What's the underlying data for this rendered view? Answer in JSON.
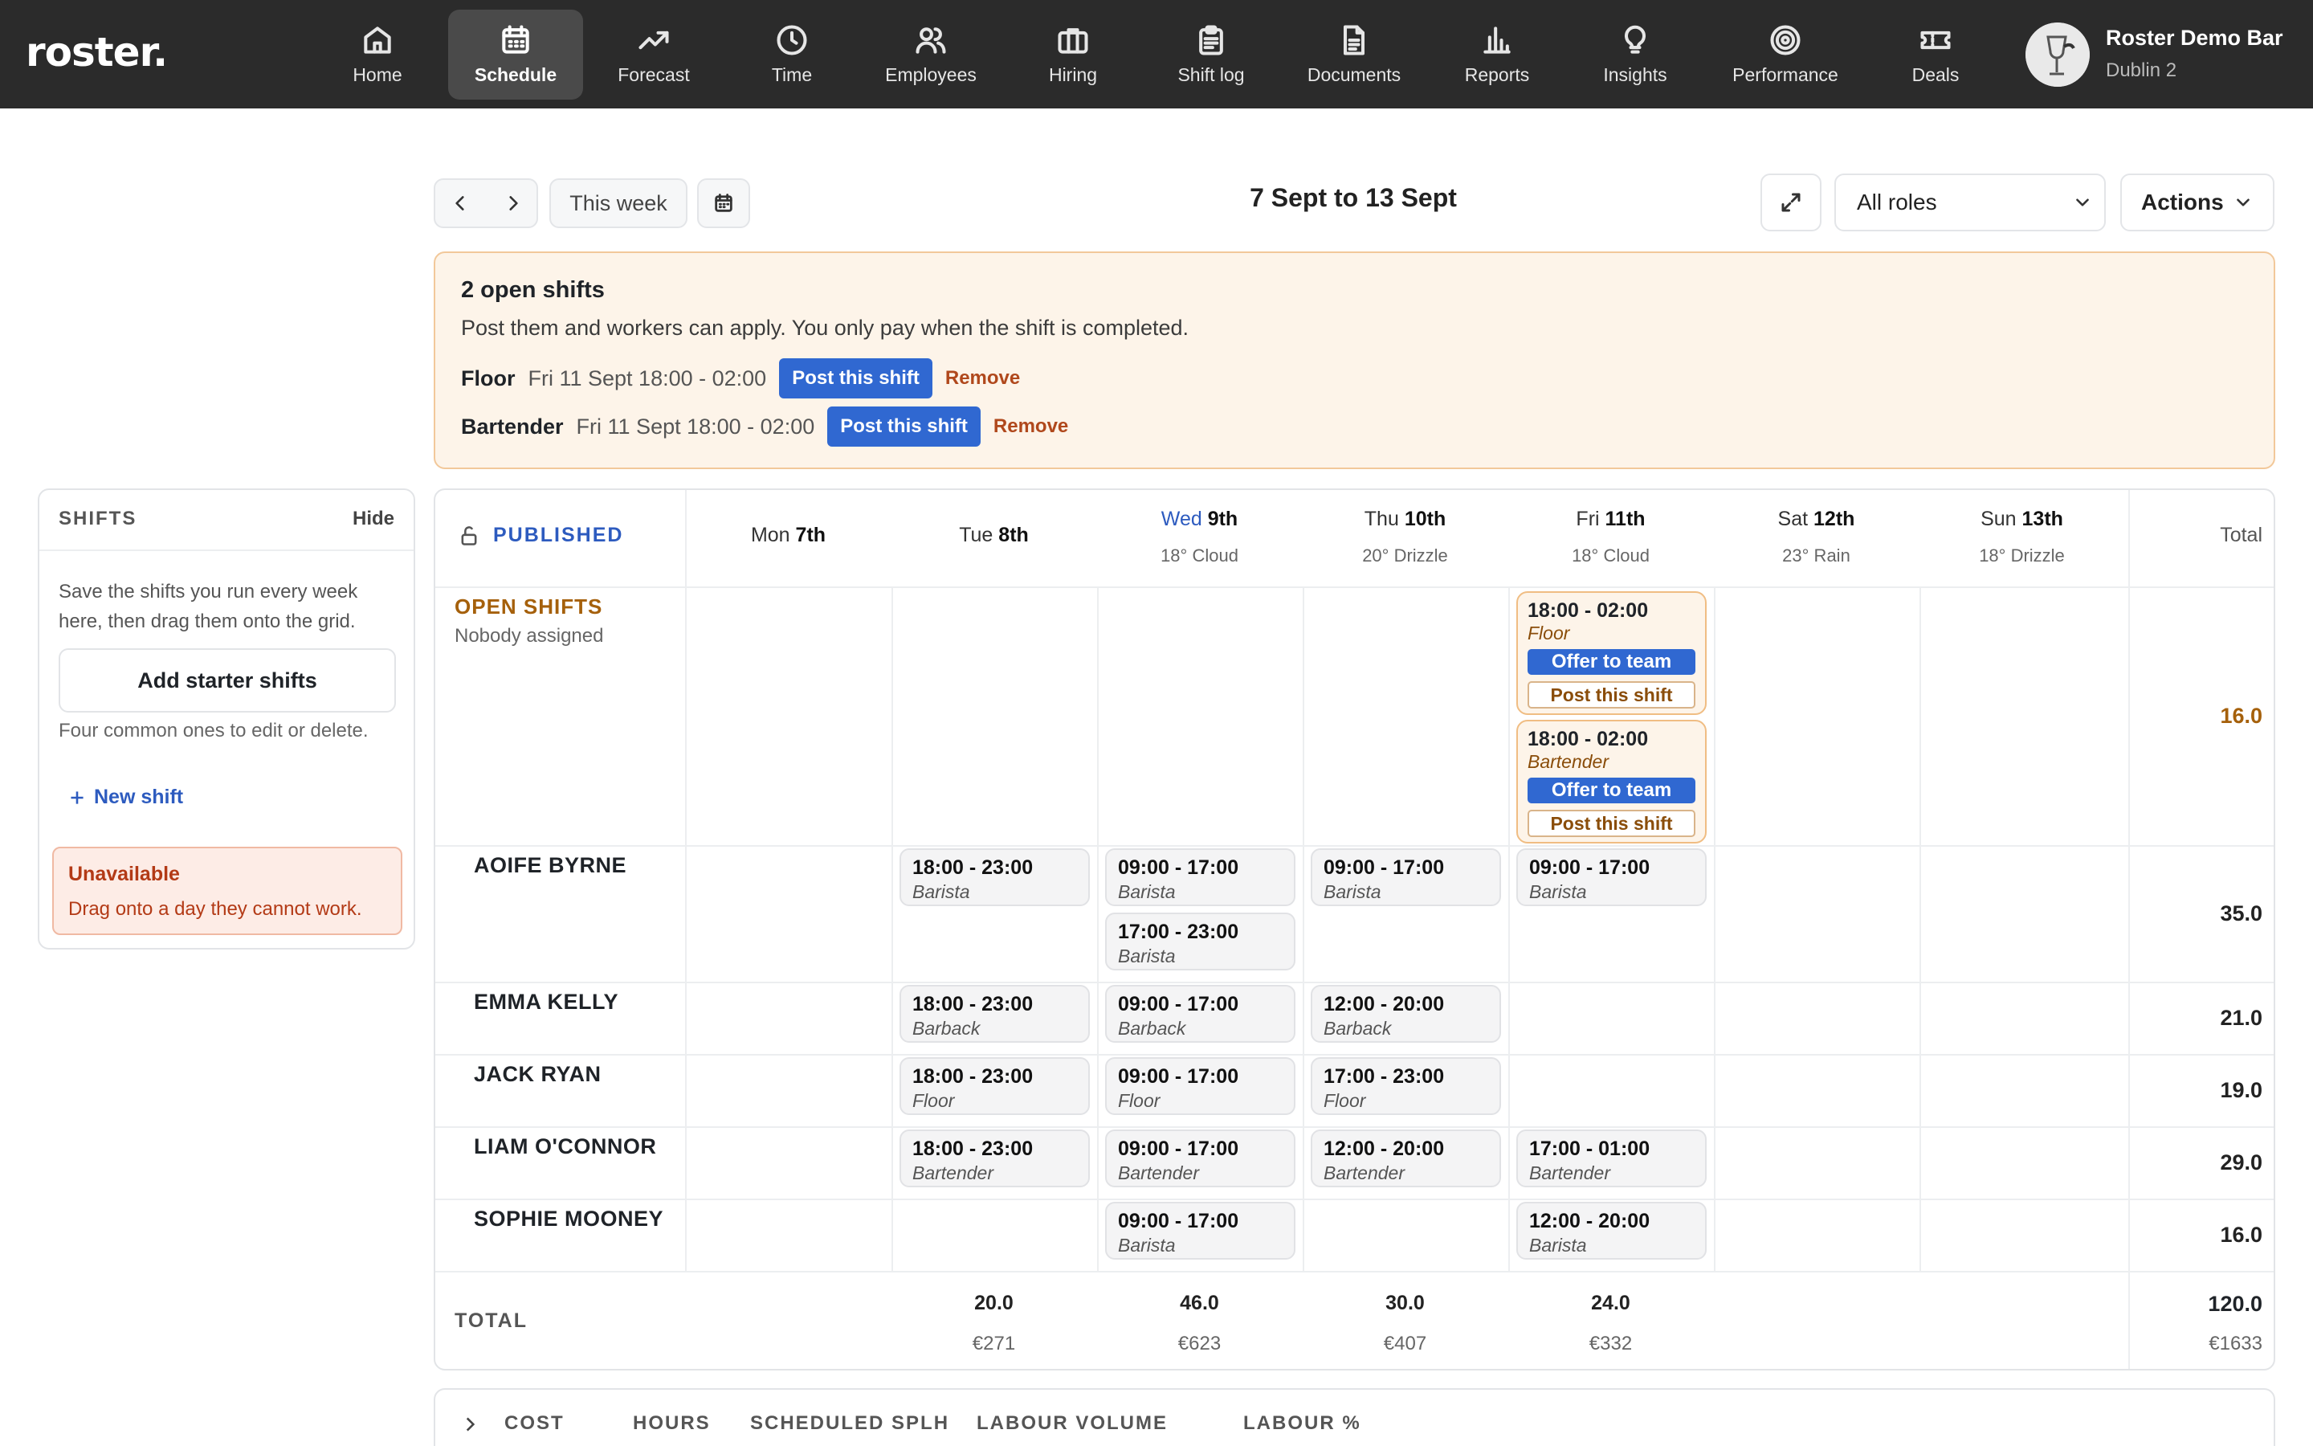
{
  "brand": {
    "logo": "roster."
  },
  "nav": [
    {
      "label": "Home",
      "icon": "home-icon"
    },
    {
      "label": "Schedule",
      "icon": "calendar-icon",
      "active": true
    },
    {
      "label": "Forecast",
      "icon": "trend-icon"
    },
    {
      "label": "Time",
      "icon": "clock-icon"
    },
    {
      "label": "Employees",
      "icon": "users-icon"
    },
    {
      "label": "Hiring",
      "icon": "briefcase-icon"
    },
    {
      "label": "Shift log",
      "icon": "clipboard-icon"
    },
    {
      "label": "Documents",
      "icon": "document-icon"
    },
    {
      "label": "Reports",
      "icon": "bar-chart-icon"
    },
    {
      "label": "Insights",
      "icon": "lightbulb-icon"
    },
    {
      "label": "Performance",
      "icon": "target-icon"
    },
    {
      "label": "Deals",
      "icon": "ticket-icon"
    }
  ],
  "account": {
    "name": "Roster Demo Bar",
    "location": "Dublin 2"
  },
  "toolbar": {
    "this_week": "This week",
    "range": "7 Sept to 13 Sept",
    "role_filter": "All roles",
    "actions": "Actions"
  },
  "banner": {
    "title": "2 open shifts",
    "desc": "Post them and workers can apply. You only pay when the shift is completed.",
    "rows": [
      {
        "role": "Floor",
        "when": "Fri 11 Sept 18:00 - 02:00",
        "post": "Post this shift",
        "remove": "Remove"
      },
      {
        "role": "Bartender",
        "when": "Fri 11 Sept 18:00 - 02:00",
        "post": "Post this shift",
        "remove": "Remove"
      }
    ]
  },
  "shifts_panel": {
    "title": "SHIFTS",
    "hide": "Hide",
    "desc": "Save the shifts you run every week here, then drag them onto the grid.",
    "add": "Add starter shifts",
    "note": "Four common ones to edit or delete.",
    "new_shift": "New shift",
    "unavailable_title": "Unavailable",
    "unavailable_desc": "Drag onto a day they cannot work."
  },
  "grid": {
    "status": "PUBLISHED",
    "total_label": "Total",
    "days": [
      {
        "dow": "Mon",
        "date": "7th",
        "weather": ""
      },
      {
        "dow": "Tue",
        "date": "8th",
        "weather": ""
      },
      {
        "dow": "Wed",
        "date": "9th",
        "weather": "18° Cloud"
      },
      {
        "dow": "Thu",
        "date": "10th",
        "weather": "20° Drizzle"
      },
      {
        "dow": "Fri",
        "date": "11th",
        "weather": "18° Cloud"
      },
      {
        "dow": "Sat",
        "date": "12th",
        "weather": "23° Rain"
      },
      {
        "dow": "Sun",
        "date": "13th",
        "weather": "18° Drizzle"
      }
    ],
    "open": {
      "title": "OPEN SHIFTS",
      "sub": "Nobody assigned",
      "total": "16.0",
      "shifts": [
        {
          "time": "18:00 - 02:00",
          "role": "Floor",
          "offer": "Offer to team",
          "post": "Post this shift"
        },
        {
          "time": "18:00 - 02:00",
          "role": "Bartender",
          "offer": "Offer to team",
          "post": "Post this shift"
        }
      ]
    },
    "employees": [
      {
        "name": "AOIFE BYRNE",
        "total": "35.0",
        "shifts": [
          {
            "time": "18:00 - 23:00",
            "role": "Barista"
          },
          {
            "time": "09:00 - 17:00",
            "role": "Barista"
          },
          {
            "time": "17:00 - 23:00",
            "role": "Barista"
          },
          {
            "time": "09:00 - 17:00",
            "role": "Barista"
          },
          {
            "time": "09:00 - 17:00",
            "role": "Barista"
          }
        ]
      },
      {
        "name": "EMMA KELLY",
        "total": "21.0",
        "shifts": [
          {
            "time": "18:00 - 23:00",
            "role": "Barback"
          },
          {
            "time": "09:00 - 17:00",
            "role": "Barback"
          },
          {
            "time": "12:00 - 20:00",
            "role": "Barback"
          }
        ]
      },
      {
        "name": "JACK RYAN",
        "total": "19.0",
        "shifts": [
          {
            "time": "18:00 - 23:00",
            "role": "Floor"
          },
          {
            "time": "09:00 - 17:00",
            "role": "Floor"
          },
          {
            "time": "17:00 - 23:00",
            "role": "Floor"
          }
        ]
      },
      {
        "name": "LIAM O'CONNOR",
        "total": "29.0",
        "shifts": [
          {
            "time": "18:00 - 23:00",
            "role": "Bartender"
          },
          {
            "time": "09:00 - 17:00",
            "role": "Bartender"
          },
          {
            "time": "12:00 - 20:00",
            "role": "Bartender"
          },
          {
            "time": "17:00 - 01:00",
            "role": "Bartender"
          }
        ]
      },
      {
        "name": "SOPHIE MOONEY",
        "total": "16.0",
        "shifts": [
          {
            "time": "09:00 - 17:00",
            "role": "Barista"
          },
          {
            "time": "12:00 - 20:00",
            "role": "Barista"
          }
        ]
      }
    ],
    "totals": {
      "label": "TOTAL",
      "days": [
        {
          "hours": "20.0",
          "cost": "€271"
        },
        {
          "hours": "46.0",
          "cost": "€623"
        },
        {
          "hours": "30.0",
          "cost": "€407"
        },
        {
          "hours": "24.0",
          "cost": "€332"
        }
      ],
      "grand_hours": "120.0",
      "grand_cost": "€1633"
    }
  },
  "metrics": [
    "COST",
    "HOURS",
    "SCHEDULED SPLH",
    "LABOUR VOLUME",
    "LABOUR %"
  ],
  "colors": {
    "nav_bg": "#2b2b2b",
    "accent_blue": "#3068d1",
    "open_orange": "#a5600b",
    "banner_bg": "#fdf4e9"
  }
}
